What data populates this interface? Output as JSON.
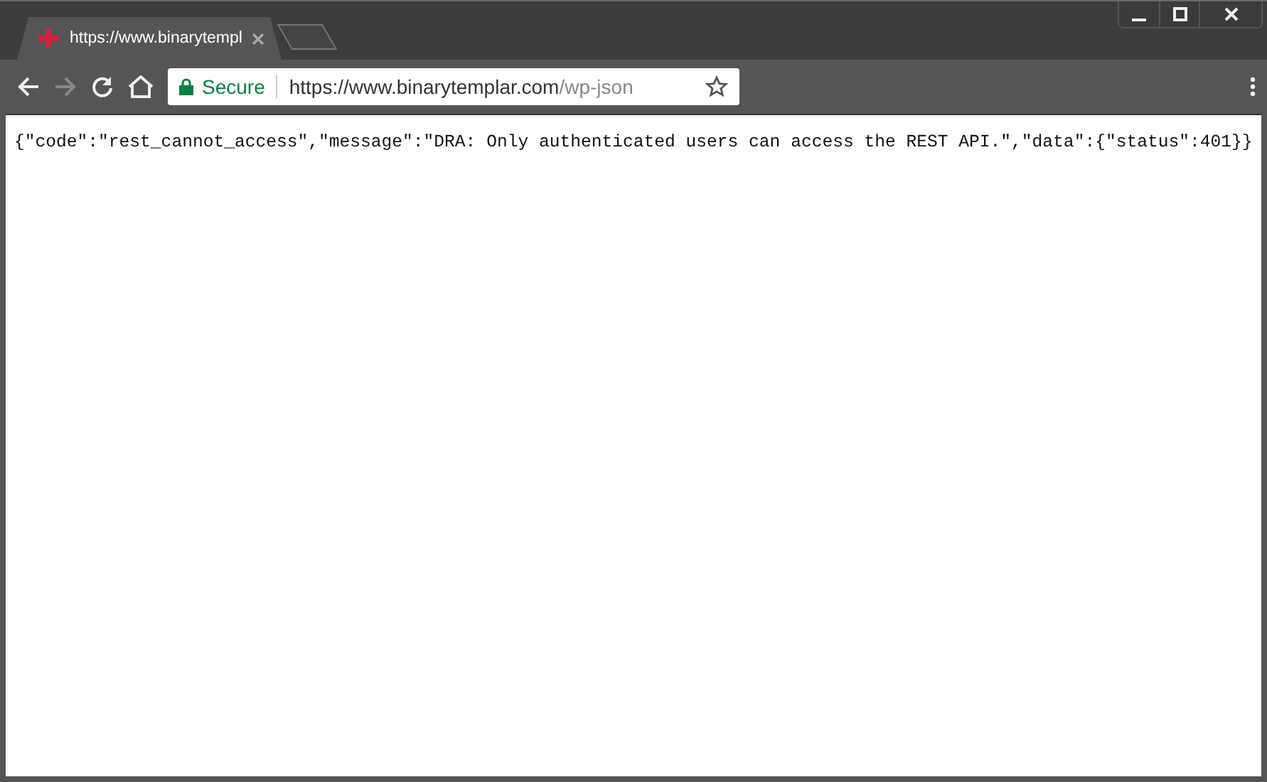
{
  "tabs": [
    {
      "title": "https://www.binarytempl",
      "selected": true
    }
  ],
  "address_bar": {
    "security": "Secure",
    "url_host": "https://www.binarytemplar.com",
    "url_path": "/wp-json"
  },
  "page": {
    "body": "{\"code\":\"rest_cannot_access\",\"message\":\"DRA: Only authenticated users can access the REST API.\",\"data\":{\"status\":401}}"
  }
}
